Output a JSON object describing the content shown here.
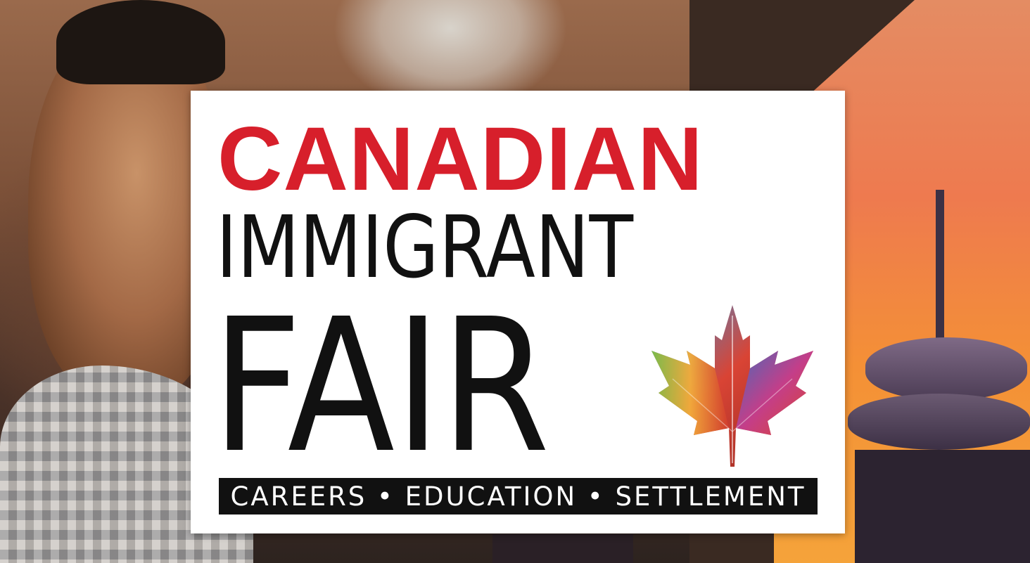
{
  "logo": {
    "line1": "CANADIAN",
    "line2": "IMMIGRANT",
    "line3": "FAIR",
    "tagline": "CAREERS • EDUCATION • SETTLEMENT"
  },
  "colors": {
    "brand_red": "#d71f2b",
    "text_black": "#111111",
    "card_white": "#ffffff"
  },
  "icons": {
    "leaf": "maple-leaf-icon"
  }
}
